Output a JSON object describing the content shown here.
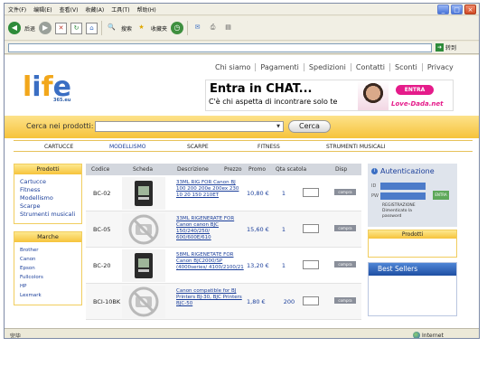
{
  "browser": {
    "menu": [
      "文件(F)",
      "编辑(E)",
      "查看(V)",
      "收藏(A)",
      "工具(T)",
      "帮助(H)"
    ],
    "toolbar": {
      "back": "后退",
      "search": "搜索",
      "favorites": "收藏夹"
    },
    "address": {
      "value": "",
      "go_label": "转到"
    },
    "status": {
      "text": "完毕",
      "zone": "Internet"
    }
  },
  "site": {
    "logo": {
      "text": "life",
      "sub": "365.eu"
    },
    "topnav": [
      "Chi siamo",
      "Pagamenti",
      "Spedizioni",
      "Contatti",
      "Sconti",
      "Privacy"
    ],
    "banner": {
      "title": "Entra in CHAT...",
      "subtitle": "C'è chi aspetta di incontrare solo te",
      "button": "ENTRA",
      "brand": "Love-Dada.net"
    },
    "search": {
      "label": "Cerca nei prodotti:",
      "button": "Cerca"
    },
    "categories": [
      "CARTUCCE",
      "MODELLISMO",
      "SCARPE",
      "FITNESS",
      "STRUMENTI MUSICALI"
    ],
    "products_box": {
      "title": "Prodotti",
      "items": [
        "Cartucce",
        "Fitness",
        "Modellismo",
        "Scarpe",
        "Strumenti musicali"
      ]
    },
    "brands_box": {
      "title": "Marche",
      "items": [
        "Brother",
        "Canon",
        "Epson",
        "Fullcolors",
        "HP",
        "Lexmark"
      ]
    },
    "table": {
      "headers": [
        "Codice",
        "Scheda",
        "Descrizione",
        "Prezzo",
        "Promo",
        "Qta scatola",
        "Disp"
      ],
      "rows": [
        {
          "code": "BC-02",
          "desc": "33ML RIG FOR Canon BJ 100 200 200e 200ex 230 10 20 150 210ET",
          "price": "10,80 €",
          "qty": "1",
          "has_image": true
        },
        {
          "code": "BC-05",
          "desc": "33ML RIGENERATE FOR Canon canon BJC 150/240/250/ 600/600E/610",
          "price": "15,60 €",
          "qty": "1",
          "has_image": false
        },
        {
          "code": "BC-20",
          "desc": "58ML RIGENETATE FOR Canon BJC2000/SP (4000series/ 4100/2100/21",
          "price": "13,20 €",
          "qty": "1",
          "has_image": true
        },
        {
          "code": "BCI-10BK",
          "desc": "Canon compatible for BJ Printers BJ-30, BJC Printers BJC-50",
          "price": "1,80 €",
          "qty": "200",
          "has_image": false
        }
      ],
      "buy_label": "compra"
    },
    "auth": {
      "title": "Autenticazione",
      "id_label": "ID",
      "pw_label": "PW",
      "go_label": "ENTRA",
      "links": [
        "REGISTRAZIONE",
        "Dimenticato la",
        "password"
      ]
    },
    "right_products": {
      "title": "Prodotti"
    },
    "best_sellers": {
      "title": "Best Sellers"
    }
  },
  "colors": {
    "accent_yellow": "#f6c33b",
    "link_blue": "#1a3e9a",
    "best_blue": "#1e4fa3"
  }
}
